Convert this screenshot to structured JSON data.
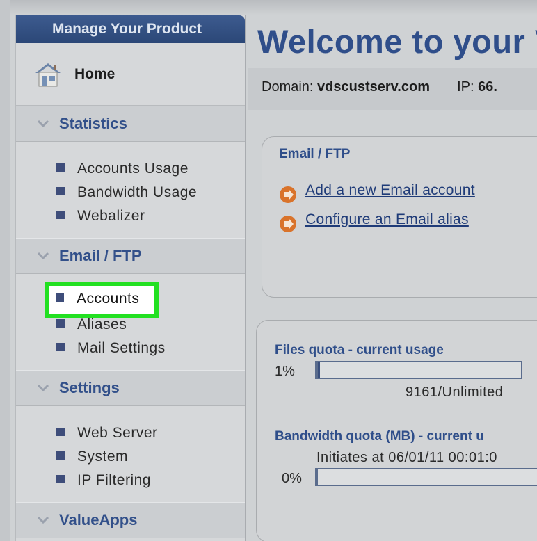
{
  "sidebar": {
    "header": "Manage Your Product",
    "home": "Home",
    "sections": [
      {
        "title": "Statistics",
        "items": [
          "Accounts Usage",
          "Bandwidth Usage",
          "Webalizer"
        ]
      },
      {
        "title": "Email / FTP",
        "items": [
          "Accounts",
          "Aliases",
          "Mail Settings"
        ]
      },
      {
        "title": "Settings",
        "items": [
          "Web Server",
          "System",
          "IP Filtering"
        ]
      },
      {
        "title": "ValueApps",
        "items": []
      }
    ],
    "highlighted_item": "Accounts"
  },
  "main": {
    "welcome": "Welcome to your V",
    "domain_label": "Domain:",
    "domain_value": "vdscustserv.com",
    "ip_label": "IP:",
    "ip_value": "66.",
    "email_panel": {
      "title": "Email / FTP",
      "links": [
        "Add a new Email account",
        "Configure an Email alias"
      ]
    },
    "quota_panel": {
      "files_title": "Files quota - current usage",
      "files_pct": "1%",
      "files_fill": 0.01,
      "files_usage": "9161/Unlimited",
      "bandwidth_title": "Bandwidth quota (MB) - current u",
      "bandwidth_initiates": "Initiates at 06/01/11 00:01:0",
      "bandwidth_pct": "0%",
      "bandwidth_fill": 0.0
    }
  },
  "colors": {
    "accent": "#2f4e8a",
    "highlight_border": "#22e021"
  }
}
